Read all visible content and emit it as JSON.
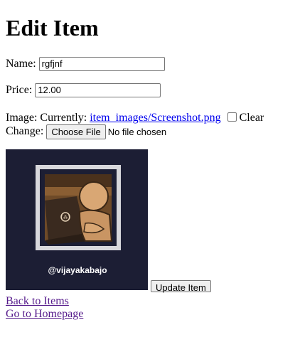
{
  "page": {
    "title": "Edit Item"
  },
  "form": {
    "name_label": "Name:",
    "name_value": "rgfjnf",
    "price_label": "Price:",
    "price_value": "12.00",
    "image_label": "Image:",
    "currently_label": "Currently:",
    "current_file": "item_images/Screenshot.png",
    "clear_label": "Clear",
    "change_label": "Change:",
    "choose_file_label": "Choose File",
    "no_file_text": "No file chosen",
    "submit_label": "Update Item"
  },
  "preview": {
    "caption": "@vijayakabajo",
    "icon": "person-at-laptop-icon"
  },
  "links": {
    "back": "Back to Items",
    "home": "Go to Homepage"
  },
  "colors": {
    "preview_bg": "#1c1e34",
    "link": "#0000ee",
    "visited_link": "#551a8b"
  }
}
